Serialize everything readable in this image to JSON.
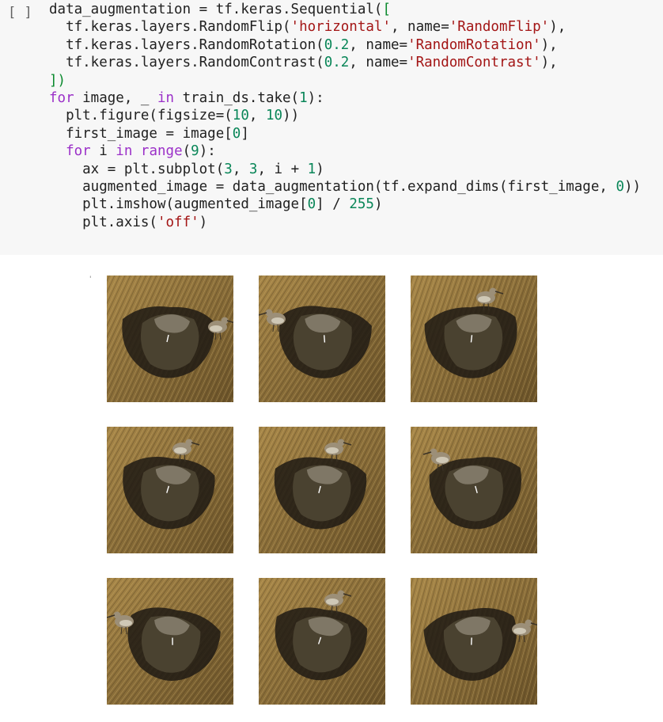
{
  "cell": {
    "run_button": "[ ]",
    "lines": [
      [
        [
          "data_augmentation = tf.keras.Sequential(",
          ""
        ],
        [
          "[",
          "br"
        ]
      ],
      [
        [
          "  tf.keras.layers.RandomFlip(",
          ""
        ],
        [
          "'horizontal'",
          "str"
        ],
        [
          ", name=",
          ""
        ],
        [
          "'RandomFlip'",
          "str"
        ],
        [
          "),",
          ""
        ]
      ],
      [
        [
          "  tf.keras.layers.RandomRotation(",
          ""
        ],
        [
          "0.2",
          "num"
        ],
        [
          ", name=",
          ""
        ],
        [
          "'RandomRotation'",
          "str"
        ],
        [
          "),",
          ""
        ]
      ],
      [
        [
          "  tf.keras.layers.RandomContrast(",
          ""
        ],
        [
          "0.2",
          "num"
        ],
        [
          ", name=",
          ""
        ],
        [
          "'RandomContrast'",
          "str"
        ],
        [
          "),",
          ""
        ]
      ],
      [
        [
          "])",
          "br"
        ]
      ],
      [
        [
          "for",
          "kw"
        ],
        [
          " image, _ ",
          ""
        ],
        [
          "in",
          "kw"
        ],
        [
          " train_ds.take(",
          ""
        ],
        [
          "1",
          "num"
        ],
        [
          "):",
          ""
        ]
      ],
      [
        [
          "  plt.figure(figsize=(",
          ""
        ],
        [
          "10",
          "num"
        ],
        [
          ", ",
          ""
        ],
        [
          "10",
          "num"
        ],
        [
          "))",
          ""
        ]
      ],
      [
        [
          "  first_image = image[",
          ""
        ],
        [
          "0",
          "num"
        ],
        [
          "]",
          ""
        ]
      ],
      [
        [
          "  ",
          ""
        ],
        [
          "for",
          "kw"
        ],
        [
          " i ",
          ""
        ],
        [
          "in",
          "kw"
        ],
        [
          " ",
          ""
        ],
        [
          "range",
          "kw"
        ],
        [
          "(",
          ""
        ],
        [
          "9",
          "num"
        ],
        [
          "):",
          ""
        ]
      ],
      [
        [
          "    ax = plt.subplot(",
          ""
        ],
        [
          "3",
          "num"
        ],
        [
          ", ",
          ""
        ],
        [
          "3",
          "num"
        ],
        [
          ", i + ",
          ""
        ],
        [
          "1",
          "num"
        ],
        [
          ")",
          ""
        ]
      ],
      [
        [
          "    augmented_image = data_augmentation(tf.expand_dims(first_image, ",
          ""
        ],
        [
          "0",
          "num"
        ],
        [
          "))",
          ""
        ]
      ],
      [
        [
          "    plt.imshow(augmented_image[",
          ""
        ],
        [
          "0",
          "num"
        ],
        [
          "] / ",
          ""
        ],
        [
          "255",
          "num"
        ],
        [
          ")",
          ""
        ]
      ],
      [
        [
          "    plt.axis(",
          ""
        ],
        [
          "'off'",
          "str"
        ],
        [
          ")",
          ""
        ]
      ]
    ]
  },
  "output": {
    "tick_mark": "'",
    "images": [
      {
        "alt": "augmented-image-1",
        "bird": "right"
      },
      {
        "alt": "augmented-image-2",
        "bird": "left"
      },
      {
        "alt": "augmented-image-3",
        "bird": "top"
      },
      {
        "alt": "augmented-image-4",
        "bird": "top"
      },
      {
        "alt": "augmented-image-5",
        "bird": "top"
      },
      {
        "alt": "augmented-image-6",
        "bird": "top-left"
      },
      {
        "alt": "augmented-image-7",
        "bird": "left"
      },
      {
        "alt": "augmented-image-8",
        "bird": "top"
      },
      {
        "alt": "augmented-image-9",
        "bird": "right"
      }
    ],
    "colors": {
      "grass": "#a88748",
      "grass_dark": "#6b5329",
      "rock": "#4a4230",
      "rock_light": "#8c8474",
      "shadow": "#1e1a14",
      "bird": "#9c8f78"
    }
  }
}
